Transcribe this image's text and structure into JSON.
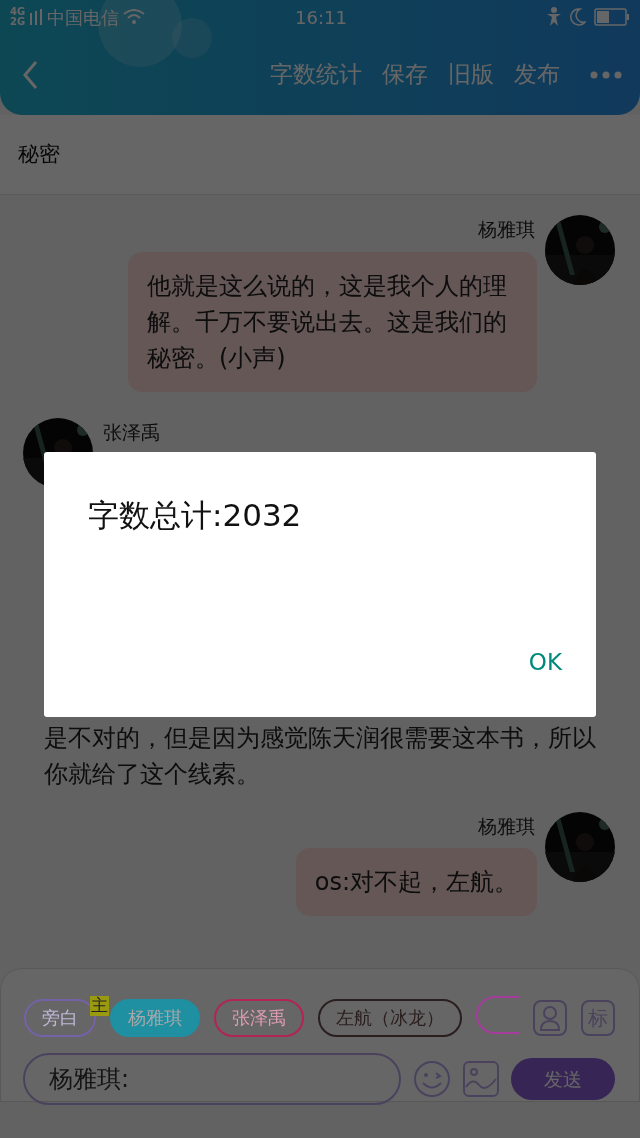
{
  "status_bar": {
    "network": [
      "4G",
      "2G"
    ],
    "carrier": "中国电信",
    "time": "16:11"
  },
  "header": {
    "actions": [
      "字数统计",
      "保存",
      "旧版",
      "发布"
    ]
  },
  "chapter_title": "秘密",
  "messages": [
    {
      "kind": "outgoing",
      "name": "杨雅琪",
      "text": "他就是这么说的，这是我个人的理解。千万不要说出去。这是我们的秘密。(小声)"
    },
    {
      "kind": "incoming",
      "name": "张泽禹"
    },
    {
      "kind": "narration",
      "text": "是不对的，但是因为感觉陈天润很需要这本书，所以你就给了这个线索。"
    },
    {
      "kind": "outgoing",
      "name": "杨雅琪",
      "text": "os:对不起，左航。"
    }
  ],
  "dialog": {
    "message": "字数总计:2032",
    "button": "OK"
  },
  "composer": {
    "roles": [
      {
        "label": "旁白",
        "color": "#7462a8",
        "selected": false
      },
      {
        "label": "杨雅琪",
        "color": "#1f8fa2",
        "selected": true,
        "badge": "主"
      },
      {
        "label": "张泽禹",
        "color": "#b22455",
        "selected": false
      },
      {
        "label": "左航（冰龙）",
        "color": "#2a1e1e",
        "selected": false
      },
      {
        "color": "#a53c9e",
        "selected": false
      }
    ],
    "tag_button": "标",
    "input_value": "杨雅琪:",
    "send": "发送"
  }
}
